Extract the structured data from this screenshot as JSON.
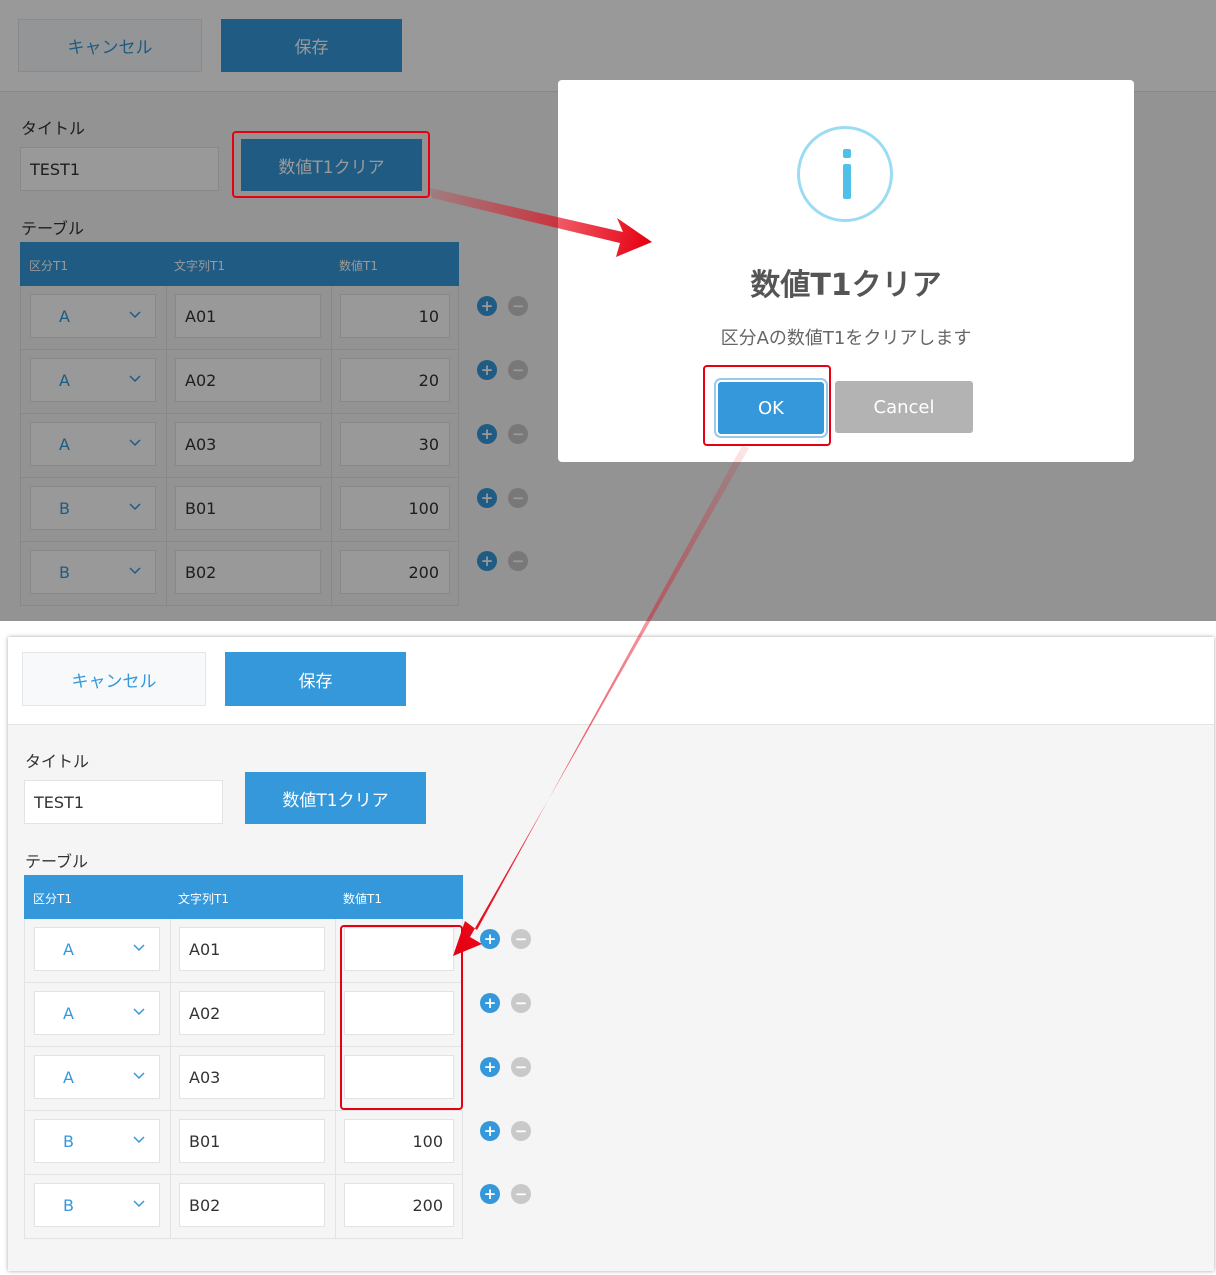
{
  "before": {
    "toolbar": {
      "cancel_label": "キャンセル",
      "save_label": "保存"
    },
    "form": {
      "title_label": "タイトル",
      "title_value": "TEST1",
      "action_label": "数値T1クリア",
      "table_label": "テーブル"
    },
    "table": {
      "headers": [
        "区分T1",
        "文字列T1",
        "数値T1"
      ],
      "rows": [
        {
          "category": "A",
          "text": "A01",
          "number": "10"
        },
        {
          "category": "A",
          "text": "A02",
          "number": "20"
        },
        {
          "category": "A",
          "text": "A03",
          "number": "30"
        },
        {
          "category": "B",
          "text": "B01",
          "number": "100"
        },
        {
          "category": "B",
          "text": "B02",
          "number": "200"
        }
      ]
    },
    "dialog": {
      "title": "数値T1クリア",
      "message": "区分Aの数値T1をクリアします",
      "ok_label": "OK",
      "cancel_label": "Cancel"
    }
  },
  "after": {
    "toolbar": {
      "cancel_label": "キャンセル",
      "save_label": "保存"
    },
    "form": {
      "title_label": "タイトル",
      "title_value": "TEST1",
      "action_label": "数値T1クリア",
      "table_label": "テーブル"
    },
    "table": {
      "headers": [
        "区分T1",
        "文字列T1",
        "数値T1"
      ],
      "rows": [
        {
          "category": "A",
          "text": "A01",
          "number": ""
        },
        {
          "category": "A",
          "text": "A02",
          "number": ""
        },
        {
          "category": "A",
          "text": "A03",
          "number": ""
        },
        {
          "category": "B",
          "text": "B01",
          "number": "100"
        },
        {
          "category": "B",
          "text": "B02",
          "number": "200"
        }
      ]
    }
  },
  "colors": {
    "accent": "#3498db",
    "highlight": "#e60012",
    "overlay": "rgba(0,0,0,0.4)",
    "info_icon": "#4fc1e9"
  },
  "icons": {
    "dialog": "info-icon",
    "row_add": "plus-circle-icon",
    "row_remove": "minus-circle-icon",
    "select": "chevron-down-icon"
  }
}
